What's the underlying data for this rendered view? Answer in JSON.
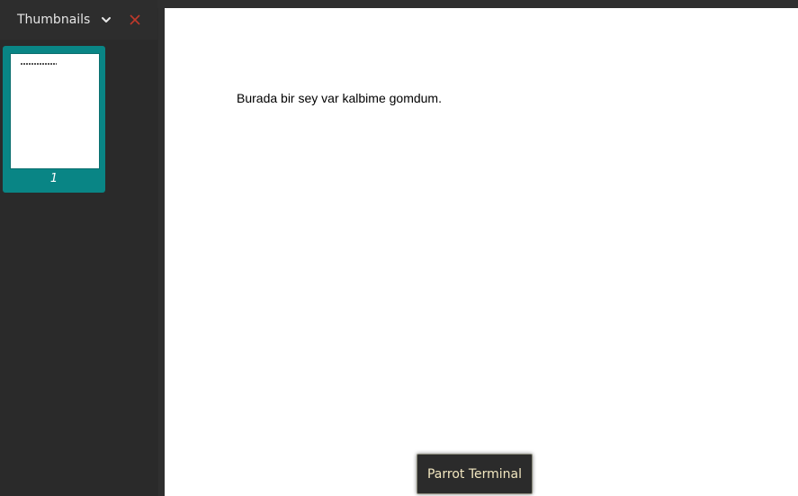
{
  "sidebar": {
    "panel_label": "Thumbnails",
    "thumbnails": [
      {
        "page_label": "1",
        "selected": true
      }
    ]
  },
  "document": {
    "text": "Burada bir sey var kalbime gomdum."
  },
  "tooltip": {
    "text": "Parrot Terminal"
  },
  "colors": {
    "accent": "#098585",
    "close_icon": "#c0392b",
    "tooltip_text": "#f2e7c0",
    "sidebar_bg": "#2a2a2a"
  },
  "icons": {
    "dropdown": "chevron-down-icon",
    "close": "close-icon"
  }
}
